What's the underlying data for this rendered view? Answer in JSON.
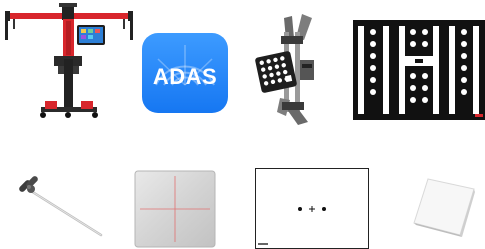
{
  "products": [
    {
      "name": "calibration-frame",
      "icon": "adas-calibration-frame"
    },
    {
      "name": "adas-logo",
      "icon": "adas-app-logo",
      "logo_text": "ADAS"
    },
    {
      "name": "target-holder",
      "icon": "wheel-clamp-target-holder"
    },
    {
      "name": "pattern-board",
      "icon": "camera-calibration-pattern-board"
    },
    {
      "name": "t-handle-tool",
      "icon": "t-handle-pointer-tool"
    },
    {
      "name": "reflector-pad",
      "icon": "reflector-pad-crosshair"
    },
    {
      "name": "dot-target",
      "icon": "three-dot-target-board"
    },
    {
      "name": "square-plate",
      "icon": "white-square-plate"
    }
  ],
  "colors": {
    "frame_red": "#d8262c",
    "logo_blue": "#1677f2",
    "logo_blue_light": "#3d9bff",
    "dark_metal": "#2b2b2b",
    "gray_metal": "#8a8a8a"
  }
}
